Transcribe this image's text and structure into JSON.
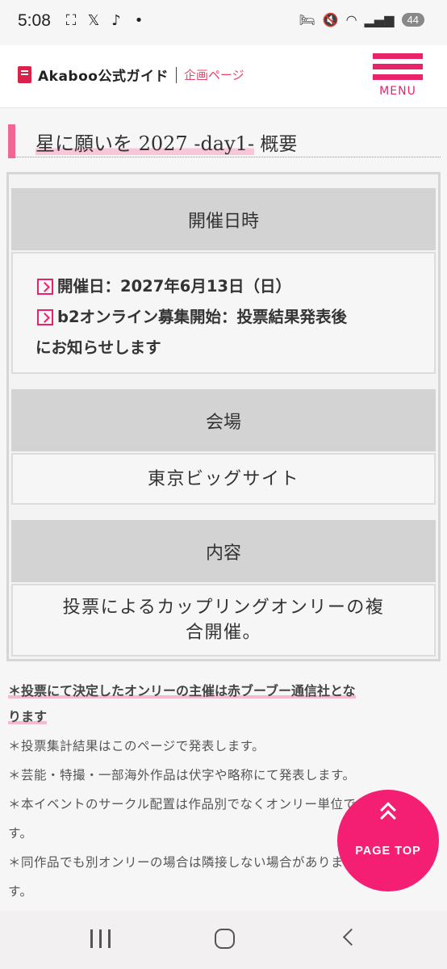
{
  "status_bar": {
    "time": "5:08",
    "battery": "44"
  },
  "header": {
    "brand": "Akaboo公式ガイド",
    "section": "企画ページ",
    "menu_label": "MENU"
  },
  "page": {
    "title_main": "星に願いを 2027 -day1-",
    "title_tail": " 概要"
  },
  "info": {
    "datetime_heading": "開催日時",
    "date_line": "開催日：2027年6月13日（日）",
    "b2_line_1": "b2オンライン募集開始：投票結果発表後",
    "b2_line_2": "にお知らせします",
    "venue_heading": "会場",
    "venue": "東京ビッグサイト",
    "content_heading": "内容",
    "content_line_1": "投票によるカップリングオンリーの複",
    "content_line_2": "合開催。"
  },
  "notes": {
    "strong_1": "＊投票にて決定したオンリーの主催は赤ブーブー通信社とな",
    "strong_2": "ります",
    "n1": "＊投票集計結果はこのページで発表します。",
    "n2": "＊芸能・特撮・一部海外作品は伏字や略称にて発表します。",
    "n3_1": "＊本イベントのサークル配置は作品別でなくオンリー単位で",
    "n3_2": "す。",
    "n4_1": "＊同作品でも別オンリーの場合は隣接しない場合がありま",
    "n4_2": "す。"
  },
  "page_top": {
    "label": "PAGE TOP"
  },
  "colors": {
    "accent": "#e8236a",
    "page_top_bg": "#f41e73"
  }
}
